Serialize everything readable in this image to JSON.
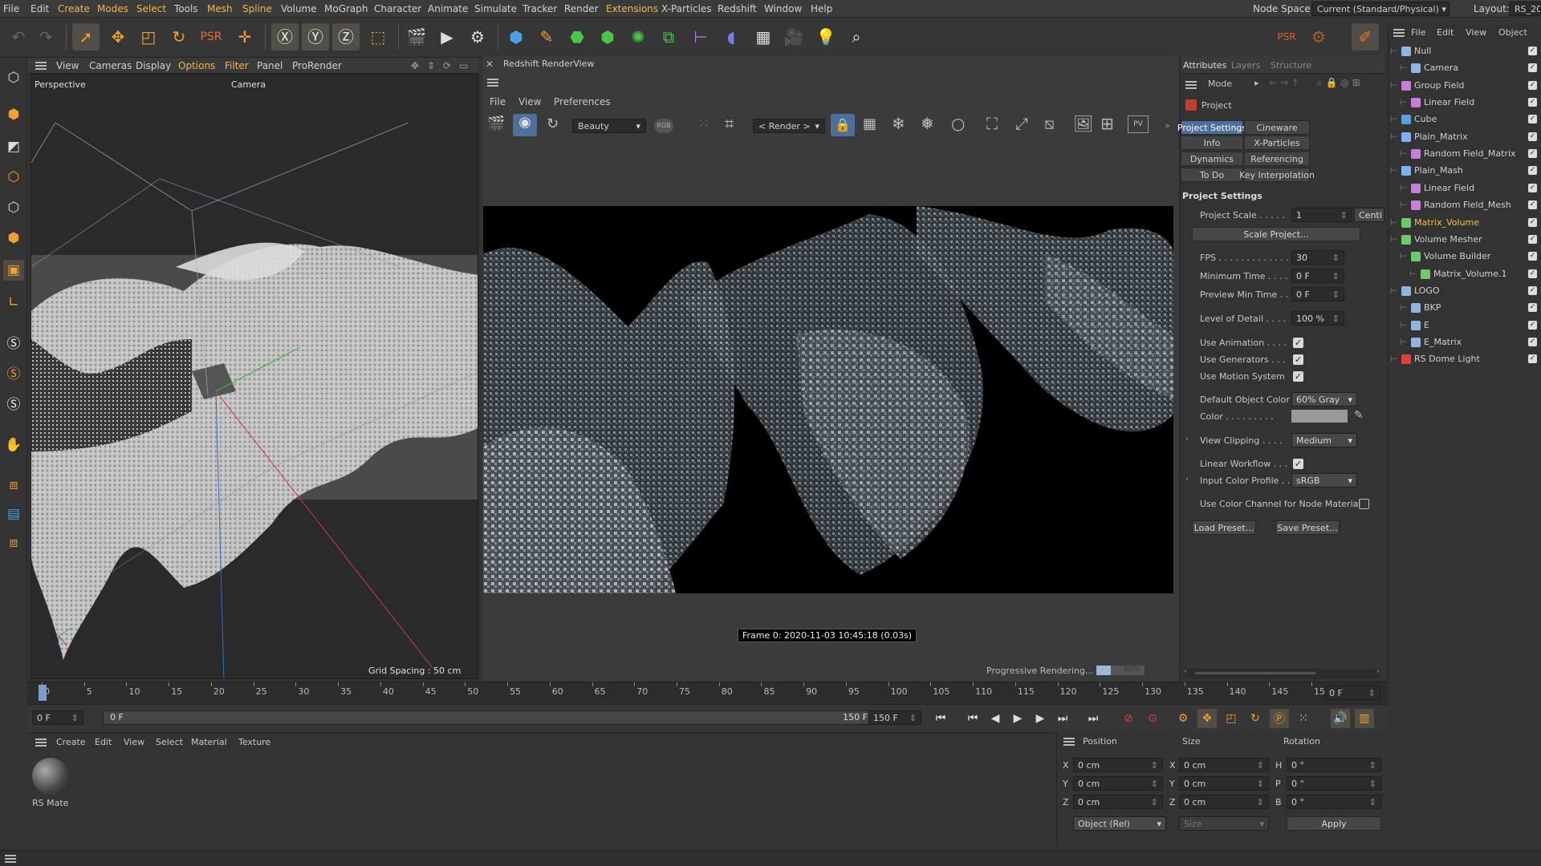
{
  "menubar": {
    "items": [
      "File",
      "Edit",
      "Create",
      "Modes",
      "Select",
      "Tools",
      "Mesh",
      "Spline",
      "Volume",
      "MoGraph",
      "Character",
      "Animate",
      "Simulate",
      "Tracker",
      "Render",
      "Extensions",
      "X-Particles",
      "Redshift",
      "Window",
      "Help"
    ],
    "node_space_label": "Node Space:",
    "node_space_value": "Current (Standard/Physical)",
    "layout_label": "Layout:",
    "layout_value": "RS_20"
  },
  "viewport": {
    "menu": [
      "View",
      "Cameras",
      "Display",
      "Options",
      "Filter",
      "Panel",
      "ProRender"
    ],
    "name": "Perspective",
    "camera": "Camera",
    "grid": "Grid Spacing : 50 cm"
  },
  "renderview": {
    "title": "Redshift RenderView",
    "menu": [
      "File",
      "View",
      "Preferences"
    ],
    "aov": "Beauty",
    "rgb": "RGB",
    "render_target": "< Render >",
    "pv": "PV",
    "frame_info": "Frame 0:  2020-11-03  10:45:18  (0.03s)",
    "progress_label": "Progressive Rendering...",
    "progress_text": "30%",
    "progress": 0.3
  },
  "attributes": {
    "tabs": [
      "Attributes",
      "Layers",
      "Structure"
    ],
    "mode": "Mode",
    "object": "Project",
    "subtabs": [
      "Project Settings",
      "Cineware",
      "Info",
      "X-Particles",
      "Dynamics",
      "Referencing",
      "To Do",
      "Key Interpolation"
    ],
    "section": "Project Settings",
    "project_scale_label": "Project Scale . . . . .",
    "project_scale": "1",
    "project_scale_unit": "Centi",
    "scale_btn": "Scale Project...",
    "fps_label": "FPS . . . . . . . . . . . . .",
    "fps": "30",
    "min_time_label": "Minimum Time . . . .",
    "min_time": "0 F",
    "prev_min_label": "Preview Min Time . .",
    "prev_min": "0 F",
    "lod_label": "Level of Detail . . . .",
    "lod": "100 %",
    "use_anim": "Use Animation . . . .",
    "use_gen": "Use Generators . . .",
    "use_motion": "Use Motion System",
    "def_color_label": "Default Object Color",
    "def_color": "60% Gray",
    "color_label": "Color . . . . . . . . .",
    "view_clip_label": "View Clipping . . . .",
    "view_clip": "Medium",
    "linear_label": "Linear Workflow . . .",
    "icp_label": "Input Color Profile . .",
    "icp": "sRGB",
    "node_color_label": "Use Color Channel for Node Material",
    "load_btn": "Load Preset...",
    "save_btn": "Save Preset..."
  },
  "objects": {
    "menu": [
      "File",
      "Edit",
      "View",
      "Object"
    ],
    "items": [
      {
        "name": "Null",
        "depth": 0,
        "color": "#8fb4e0"
      },
      {
        "name": "Camera",
        "depth": 1,
        "color": "#8fb4e0"
      },
      {
        "name": "Group Field",
        "depth": 0,
        "color": "#c77ed6"
      },
      {
        "name": "Linear Field",
        "depth": 1,
        "color": "#c77ed6"
      },
      {
        "name": "Cube",
        "depth": 0,
        "color": "#5aa0e0"
      },
      {
        "name": "Plain_Matrix",
        "depth": 0,
        "color": "#7fb0ff"
      },
      {
        "name": "Random Field_Matrix",
        "depth": 1,
        "color": "#c77ed6"
      },
      {
        "name": "Plain_Mash",
        "depth": 0,
        "color": "#7fb0ff"
      },
      {
        "name": "Linear Field",
        "depth": 1,
        "color": "#c77ed6"
      },
      {
        "name": "Random Field_Mesh",
        "depth": 1,
        "color": "#c77ed6"
      },
      {
        "name": "Matrix_Volume",
        "depth": 0,
        "color": "#6ec86e",
        "highlight": true
      },
      {
        "name": "Volume Mesher",
        "depth": 0,
        "color": "#6ec86e"
      },
      {
        "name": "Volume Builder",
        "depth": 1,
        "color": "#6ec86e"
      },
      {
        "name": "Matrix_Volume.1",
        "depth": 2,
        "color": "#6ec86e"
      },
      {
        "name": "LOGO",
        "depth": 0,
        "color": "#8fb4e0"
      },
      {
        "name": "BKP",
        "depth": 1,
        "color": "#8fb4e0"
      },
      {
        "name": "E",
        "depth": 1,
        "color": "#8fb4e0"
      },
      {
        "name": "E_Matrix",
        "depth": 1,
        "color": "#8fb4e0"
      },
      {
        "name": "RS Dome Light",
        "depth": 0,
        "color": "#e04040"
      }
    ]
  },
  "timeline": {
    "ticks": [
      "0",
      "5",
      "10",
      "15",
      "20",
      "25",
      "30",
      "35",
      "40",
      "45",
      "50",
      "55",
      "60",
      "65",
      "70",
      "75",
      "80",
      "85",
      "90",
      "95",
      "100",
      "105",
      "110",
      "115",
      "120",
      "125",
      "130",
      "135",
      "140",
      "145",
      "150"
    ],
    "current": "0 F"
  },
  "transport": {
    "start": "0 F",
    "range_start": "0 F",
    "range_end": "150 F",
    "end": "150 F"
  },
  "materials": {
    "menu": [
      "Create",
      "Edit",
      "View",
      "Select",
      "Material",
      "Texture"
    ],
    "mat_name": "RS Mate"
  },
  "coords": {
    "headers": [
      "Position",
      "Size",
      "Rotation"
    ],
    "axes": [
      "X",
      "Y",
      "Z"
    ],
    "rot_axes": [
      "H",
      "P",
      "B"
    ],
    "pos": [
      "0 cm",
      "0 cm",
      "0 cm"
    ],
    "size": [
      "0 cm",
      "0 cm",
      "0 cm"
    ],
    "rot": [
      "0 °",
      "0 °",
      "0 °"
    ],
    "mode": "Object (Rel)",
    "size_mode": "Size",
    "apply": "Apply"
  }
}
